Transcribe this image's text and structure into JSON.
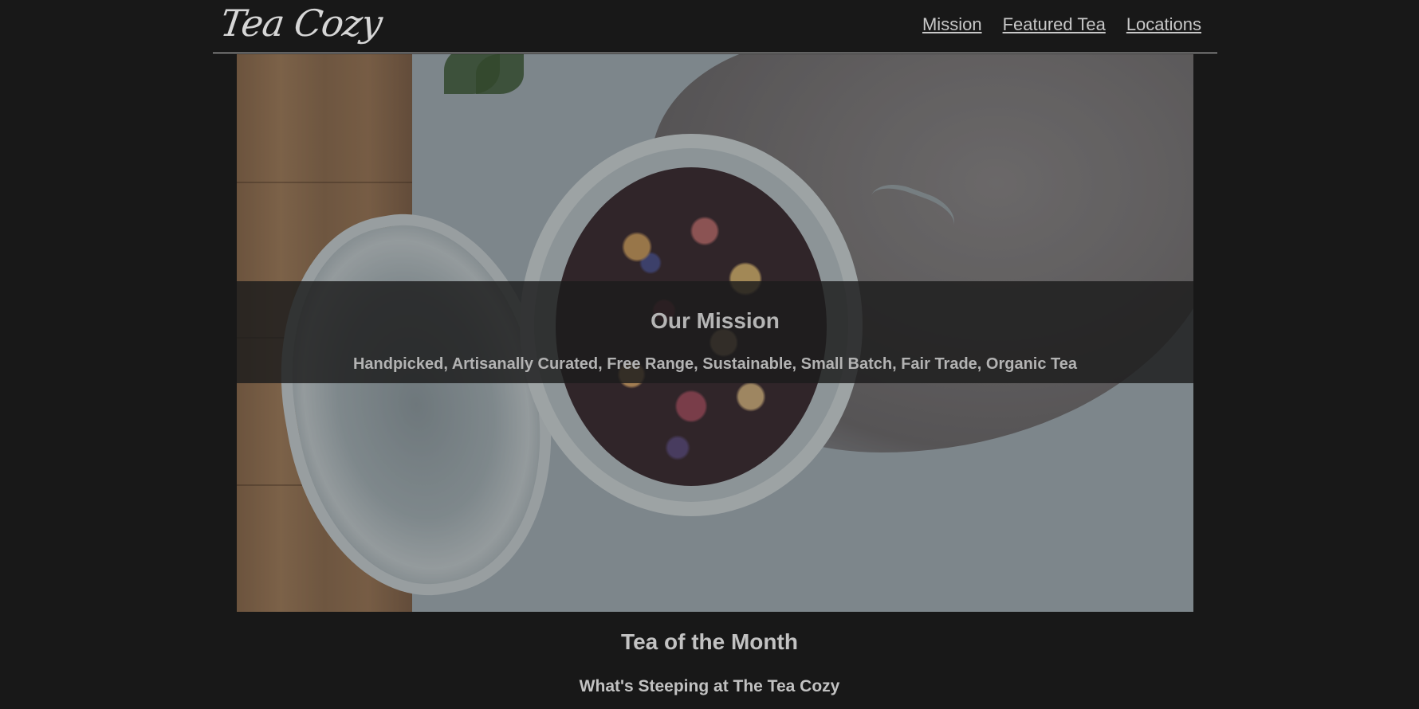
{
  "header": {
    "logo": "Tea Cozy",
    "nav": [
      {
        "label": "Mission"
      },
      {
        "label": "Featured Tea"
      },
      {
        "label": "Locations"
      }
    ]
  },
  "hero": {
    "title": "Our Mission",
    "subtitle": "Handpicked, Artisanally Curated, Free Range, Sustainable, Small Batch, Fair Trade, Organic Tea"
  },
  "section": {
    "title": "Tea of the Month",
    "subtitle": "What's Steeping at The Tea Cozy"
  },
  "colors": {
    "background": "#181818",
    "text": "#c2c2c2",
    "band": "#1c1c1c"
  }
}
